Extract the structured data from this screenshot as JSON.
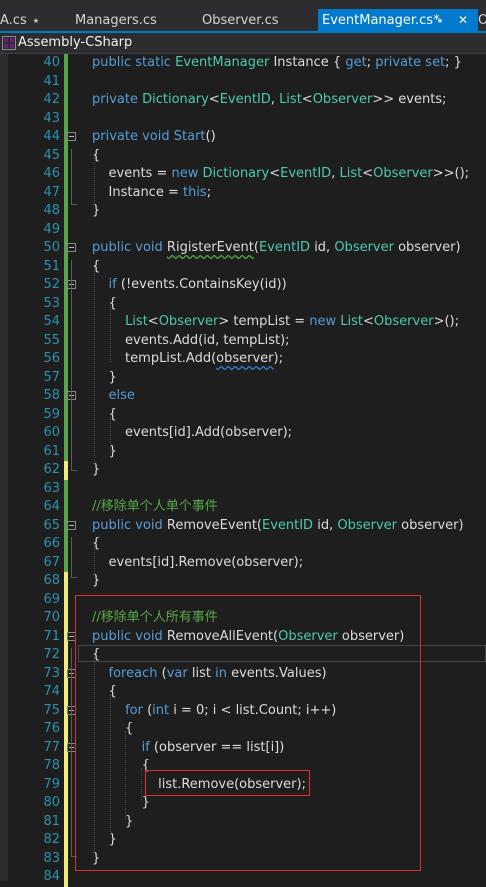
{
  "tabs": [
    {
      "label": "A.cs"
    },
    {
      "label": "Managers.cs"
    },
    {
      "label": "Observer.cs"
    },
    {
      "label": "EventManager.cs*",
      "active": true
    },
    {
      "label": "O"
    }
  ],
  "pin_glyph": "⭑",
  "close_glyph": "✕",
  "project": {
    "name": "Assembly-CSharp",
    "icon": "csharp-project-icon"
  },
  "colors": {
    "keyword": "#569cd6",
    "type": "#4ec9b0",
    "comment": "#57a64a",
    "line_number": "#2b91af",
    "accent": "#007acc",
    "highlight": "#e0302d"
  },
  "lines": [
    {
      "n": "40",
      "bar": "saved",
      "html": "<span class=\"kw\">public</span> <span class=\"kw\">static</span> <span class=\"ty\">EventManager</span> Instance { <span class=\"kw\">get</span>; <span class=\"kw\">private</span> <span class=\"kw\">set</span>; }"
    },
    {
      "n": "41",
      "bar": "saved",
      "html": ""
    },
    {
      "n": "42",
      "bar": "saved",
      "html": "<span class=\"kw\">private</span> <span class=\"ty\">Dictionary</span>&lt;<span class=\"ty\">EventID</span>, <span class=\"ty\">List</span>&lt;<span class=\"ty\">Observer</span>&gt;&gt; events;"
    },
    {
      "n": "43",
      "bar": "saved",
      "html": ""
    },
    {
      "n": "44",
      "bar": "saved",
      "html": "<span class=\"kw\">private</span> <span class=\"kw\">void</span> <span class=\"kw\">Start</span>()"
    },
    {
      "n": "45",
      "bar": "saved",
      "html": "{"
    },
    {
      "n": "46",
      "bar": "saved",
      "html": "    events = <span class=\"kw\">new</span> <span class=\"ty\">Dictionary</span>&lt;<span class=\"ty\">EventID</span>, <span class=\"ty\">List</span>&lt;<span class=\"ty\">Observer</span>&gt;&gt;();"
    },
    {
      "n": "47",
      "bar": "saved",
      "html": "    Instance = <span class=\"kw\">this</span>;"
    },
    {
      "n": "48",
      "bar": "saved",
      "html": "}"
    },
    {
      "n": "49",
      "bar": "saved",
      "html": ""
    },
    {
      "n": "50",
      "bar": "saved",
      "html": "<span class=\"kw\">public</span> <span class=\"kw\">void</span> <span class=\"squiggle\">RigisterEvent</span>(<span class=\"ty\">EventID</span> id, <span class=\"ty\">Observer</span> observer)"
    },
    {
      "n": "51",
      "bar": "saved",
      "html": "{"
    },
    {
      "n": "52",
      "bar": "saved",
      "html": "    <span class=\"kw\">if</span> (!events.ContainsKey(id))"
    },
    {
      "n": "53",
      "bar": "saved",
      "html": "    {"
    },
    {
      "n": "54",
      "bar": "saved",
      "html": "        <span class=\"ty\">List</span>&lt;<span class=\"ty\">Observer</span>&gt; tempList = <span class=\"kw\">new</span> <span class=\"ty\">List</span>&lt;<span class=\"ty\">Observer</span>&gt;();"
    },
    {
      "n": "55",
      "bar": "saved",
      "html": "        events.Add(id, tempList);"
    },
    {
      "n": "56",
      "bar": "saved",
      "html": "        tempList.Add(<span class=\"squiggle-blue\">observer</span>);"
    },
    {
      "n": "57",
      "bar": "saved",
      "html": "    }"
    },
    {
      "n": "58",
      "bar": "saved",
      "html": "    <span class=\"kw\">else</span>"
    },
    {
      "n": "59",
      "bar": "saved",
      "html": "    {"
    },
    {
      "n": "60",
      "bar": "saved",
      "html": "        events[id].Add(observer);"
    },
    {
      "n": "61",
      "bar": "saved",
      "html": "    }"
    },
    {
      "n": "62",
      "bar": "unsaved",
      "html": "}"
    },
    {
      "n": "63",
      "bar": "saved",
      "html": ""
    },
    {
      "n": "64",
      "bar": "saved",
      "html": "<span class=\"cm\">//移除单个人单个事件</span>"
    },
    {
      "n": "65",
      "bar": "saved",
      "html": "<span class=\"kw\">public</span> <span class=\"kw\">void</span> RemoveEvent(<span class=\"ty\">EventID</span> id, <span class=\"ty\">Observer</span> observer)"
    },
    {
      "n": "66",
      "bar": "saved",
      "html": "{"
    },
    {
      "n": "67",
      "bar": "saved",
      "html": "    events[id].Remove(observer);"
    },
    {
      "n": "68",
      "bar": "unsaved",
      "html": "}"
    },
    {
      "n": "69",
      "bar": "unsaved",
      "html": ""
    },
    {
      "n": "70",
      "bar": "unsaved",
      "html": "<span class=\"cm\">//移除单个人所有事件</span>"
    },
    {
      "n": "71",
      "bar": "unsaved",
      "html": "<span class=\"kw\">public</span> <span class=\"kw\">void</span> RemoveAllEvent(<span class=\"ty\">Observer</span> observer)"
    },
    {
      "n": "72",
      "bar": "unsaved",
      "html": "{"
    },
    {
      "n": "73",
      "bar": "unsaved",
      "html": "    <span class=\"kw\">foreach</span> (<span class=\"kw\">var</span> list <span class=\"kw\">in</span> events.Values)"
    },
    {
      "n": "74",
      "bar": "unsaved",
      "html": "    {"
    },
    {
      "n": "75",
      "bar": "unsaved",
      "html": "        <span class=\"kw\">for</span> (<span class=\"kw\">int</span> i = 0; i &lt; list.Count; i++)"
    },
    {
      "n": "76",
      "bar": "unsaved",
      "html": "        {"
    },
    {
      "n": "77",
      "bar": "unsaved",
      "html": "            <span class=\"kw\">if</span> (observer == list[i])"
    },
    {
      "n": "78",
      "bar": "unsaved",
      "html": "            {"
    },
    {
      "n": "79",
      "bar": "unsaved",
      "html": "                list.Remove(observer);"
    },
    {
      "n": "80",
      "bar": "unsaved",
      "html": "            }"
    },
    {
      "n": "81",
      "bar": "unsaved",
      "html": "        }"
    },
    {
      "n": "82",
      "bar": "unsaved",
      "html": "    }"
    },
    {
      "n": "83",
      "bar": "unsaved",
      "html": "}"
    },
    {
      "n": "84",
      "bar": "unsaved",
      "html": ""
    }
  ]
}
